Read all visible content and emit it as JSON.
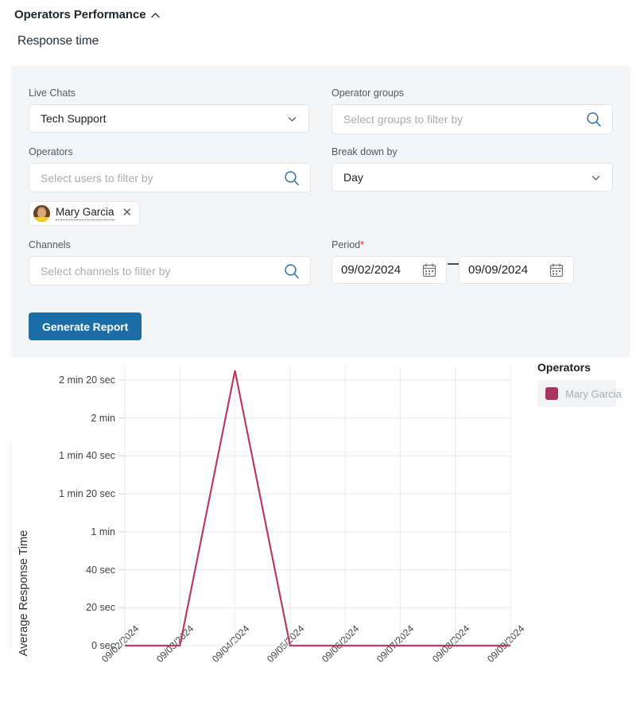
{
  "header": {
    "title": "Operators Performance",
    "collapse_icon": "chevron-up-icon"
  },
  "section": {
    "title": "Response time"
  },
  "filters": {
    "live_chats": {
      "label": "Live Chats",
      "value": "Tech Support",
      "caret_icon": "chevron-down-icon"
    },
    "operator_groups": {
      "label": "Operator groups",
      "placeholder": "Select groups to filter by",
      "search_icon": "search-icon"
    },
    "operators": {
      "label": "Operators",
      "placeholder": "Select users to filter by",
      "search_icon": "search-icon",
      "chips": [
        {
          "name": "Mary Garcia",
          "remove_icon": "close-icon",
          "avatar": "user-avatar"
        }
      ]
    },
    "break_down_by": {
      "label": "Break down by",
      "value": "Day",
      "caret_icon": "chevron-down-icon"
    },
    "channels": {
      "label": "Channels",
      "placeholder": "Select channels to filter by",
      "search_icon": "search-icon"
    },
    "period": {
      "label": "Period",
      "required_marker": "*",
      "from": "09/02/2024",
      "to": "09/09/2024",
      "separator": "—",
      "calendar_icon": "calendar-icon"
    },
    "generate_button": "Generate Report"
  },
  "legend": {
    "title": "Operators",
    "items": [
      {
        "label": "Mary Garcia",
        "color": "#a9355e"
      }
    ]
  },
  "chart_data": {
    "type": "line",
    "title": "Response time",
    "xlabel": "",
    "ylabel": "Average Response Time",
    "categories": [
      "09/02/2024",
      "09/03/2024",
      "09/04/2024",
      "09/05/2024",
      "09/06/2024",
      "09/07/2024",
      "09/08/2024",
      "09/09/2024"
    ],
    "ytick_labels": [
      "0 sec",
      "20 sec",
      "40 sec",
      "1 min",
      "1 min 20 sec",
      "1 min 40 sec",
      "2 min",
      "2 min 20 sec"
    ],
    "ytick_values": [
      0,
      20,
      40,
      60,
      80,
      100,
      120,
      140
    ],
    "ylim": [
      0,
      145
    ],
    "grid": true,
    "legend_position": "right",
    "series": [
      {
        "name": "Mary Garcia",
        "color": "#bc3b62",
        "values": [
          0,
          0,
          145,
          0,
          0,
          0,
          0,
          0
        ]
      }
    ]
  }
}
